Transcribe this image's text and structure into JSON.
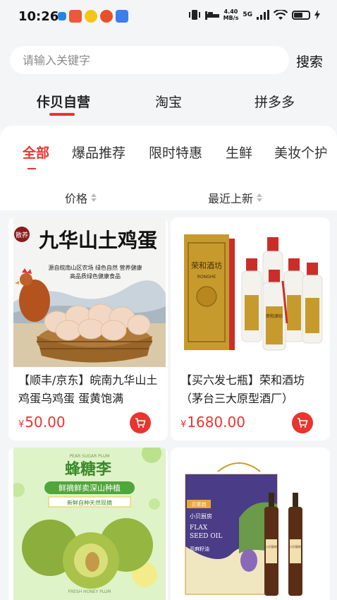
{
  "status_bar": {
    "time": "10:26",
    "speed_value": "4.40",
    "speed_unit": "MB/s",
    "network": "5G"
  },
  "search": {
    "placeholder": "请输入关键字",
    "button_label": "搜索"
  },
  "source_tabs": [
    {
      "label": "佧贝自营",
      "active": true
    },
    {
      "label": "淘宝",
      "active": false
    },
    {
      "label": "拼多多",
      "active": false
    }
  ],
  "category_tabs": [
    {
      "label": "全部",
      "active": true
    },
    {
      "label": "爆品推荐",
      "active": false
    },
    {
      "label": "限时特惠",
      "active": false
    },
    {
      "label": "生鲜",
      "active": false
    },
    {
      "label": "美妆个护",
      "active": false
    }
  ],
  "sort_options": [
    {
      "label": "价格"
    },
    {
      "label": "最近上新"
    }
  ],
  "accent_color": "#e8352f",
  "products": [
    {
      "title": "【顺丰/京东】皖南九华山土鸡蛋乌鸡蛋 蛋黄饱满",
      "currency": "¥",
      "price": "50.00",
      "image": {
        "badge": "散养",
        "headline": "九华山土鸡蛋",
        "line1": "源自皖南山区农场 绿色自然 营养健康",
        "line2": "高品质绿色健康食品"
      }
    },
    {
      "title": "【买六发七瓶】荣和酒坊（茅台三大原型酒厂）",
      "currency": "¥",
      "price": "1680.00",
      "image": {
        "box_text": "荣和酒坊",
        "box_latin": "RONGHE",
        "bottle_text": "荣和酒坊"
      }
    },
    {
      "title": "",
      "currency": "",
      "price": "",
      "image": {
        "headline": "蜂糖李",
        "line1": "鲜摘鲜卖深山种植",
        "line2": "新鲜自种天然现摘",
        "latin_top": "PEAR SUGAR PLUM",
        "latin_bottom": "FRESH HONEY PLUM"
      }
    },
    {
      "title": "",
      "currency": "",
      "price": "",
      "image": {
        "box_brand": "贝萃岗",
        "box_name": "小贝厨房",
        "box_latin1": "FLAX",
        "box_latin2": "SEED OIL",
        "box_sub": "亚麻籽油",
        "bottle_label": "小贝厨房"
      }
    }
  ]
}
